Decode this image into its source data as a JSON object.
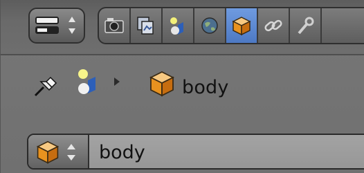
{
  "context_tabs": [
    {
      "name": "render",
      "icon": "camera-icon",
      "active": false
    },
    {
      "name": "render-layers",
      "icon": "layers-icon",
      "active": false
    },
    {
      "name": "scene",
      "icon": "scene-icon",
      "active": false
    },
    {
      "name": "world",
      "icon": "world-icon",
      "active": false
    },
    {
      "name": "object",
      "icon": "object-cube-icon",
      "active": true
    },
    {
      "name": "constraints",
      "icon": "chain-link-icon",
      "active": false
    },
    {
      "name": "modifiers",
      "icon": "wrench-icon",
      "active": false
    }
  ],
  "breadcrumb": {
    "pin_icon": "pin-icon",
    "scene_icon": "scene-icon",
    "separator_icon": "triangle-right-icon",
    "object_icon": "object-cube-icon",
    "object_name": "body"
  },
  "object_selector": {
    "type_icon": "object-cube-icon",
    "name": "body"
  },
  "colors": {
    "active_tab": "#5b87d4",
    "cube_orange": "#e8921f",
    "panel_bg": "#727272"
  }
}
